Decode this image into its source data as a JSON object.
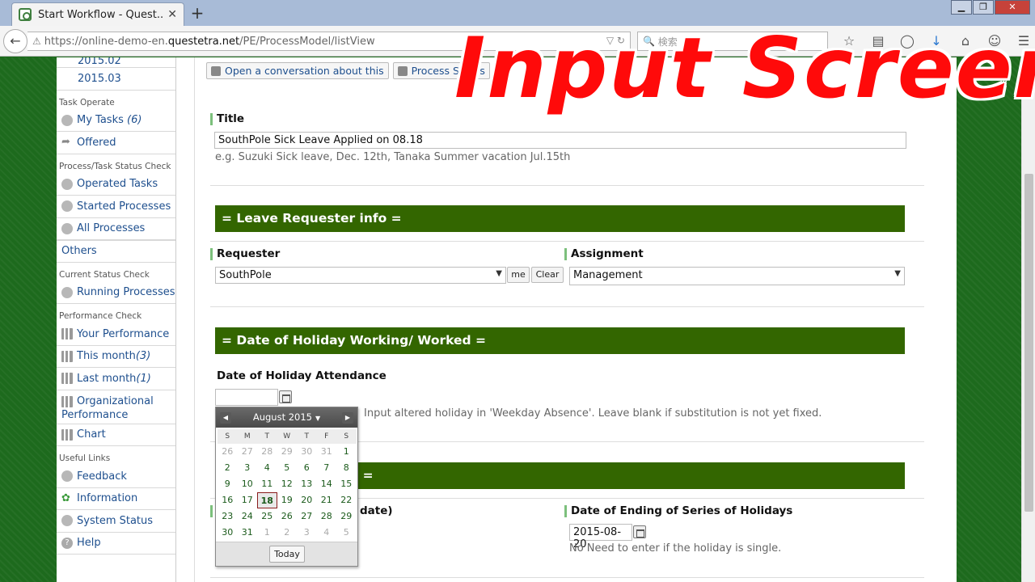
{
  "browser": {
    "tab_title": "Start Workflow - Quest...",
    "tab_close": "✕",
    "new_tab": "+",
    "url_prefix": "https://online-demo-en.",
    "url_host": "questetra.net",
    "url_path": "/PE/ProcessModel/listView",
    "search_placeholder": "検索",
    "window_controls": [
      "▁",
      "❐",
      "✕"
    ]
  },
  "overlay_title": "Input Screen",
  "sidebar": {
    "items_top": [
      {
        "label": "2015.02"
      },
      {
        "label": "2015.03"
      }
    ],
    "task_operate": {
      "heading": "Task Operate",
      "my_tasks": "My Tasks",
      "my_tasks_count": "(6)",
      "offered": "Offered"
    },
    "status_check": {
      "heading": "Process/Task Status Check",
      "operated": "Operated Tasks",
      "started": "Started Processes",
      "all": "All Processes"
    },
    "others": "Others",
    "current": {
      "heading": "Current Status Check",
      "running": "Running Processes"
    },
    "performance": {
      "heading": "Performance Check",
      "yours": "Your Performance",
      "this_month": "This month",
      "this_month_count": "(3)",
      "last_month": "Last month",
      "last_month_count": "(1)",
      "org_line1": "Organizational",
      "org_line2": "Performance",
      "chart": "Chart"
    },
    "links": {
      "heading": "Useful Links",
      "feedback": "Feedback",
      "information": "Information",
      "system_status": "System Status",
      "help": "Help"
    }
  },
  "toolbar": {
    "conversation": "Open a conversation about this",
    "process_status": "Process Status"
  },
  "form": {
    "title_label": "Title",
    "title_value": "SouthPole Sick Leave Applied on 08.18",
    "title_hint": "e.g. Suzuki Sick leave, Dec. 12th, Tanaka Summer vacation Jul.15th",
    "section_requester": "= Leave Requester info =",
    "requester_label": "Requester",
    "requester_value": "SouthPole",
    "me_button": "me",
    "clear_button": "Clear",
    "assignment_label": "Assignment",
    "assignment_value": "Management",
    "section_date": "= Date of Holiday Working/ Worked =",
    "attendance_label": "Date of Holiday Attendance",
    "attendance_value": "",
    "attendance_hint": "Input altered holiday in 'Weekday Absence'. Leave blank if substitution is not yet fixed.",
    "section_third_tail": "s =",
    "start_label_tail": "date)",
    "end_label": "Date of Ending of Series of Holidays",
    "end_value": "2015-08-20",
    "end_hint": "No Need to enter if the holiday is single."
  },
  "datepicker": {
    "month_label": "August 2015",
    "weekdays": [
      "S",
      "M",
      "T",
      "W",
      "T",
      "F",
      "S"
    ],
    "days": [
      {
        "d": "26",
        "other": true
      },
      {
        "d": "27",
        "other": true
      },
      {
        "d": "28",
        "other": true
      },
      {
        "d": "29",
        "other": true
      },
      {
        "d": "30",
        "other": true
      },
      {
        "d": "31",
        "other": true
      },
      {
        "d": "1"
      },
      {
        "d": "2"
      },
      {
        "d": "3"
      },
      {
        "d": "4"
      },
      {
        "d": "5"
      },
      {
        "d": "6"
      },
      {
        "d": "7"
      },
      {
        "d": "8"
      },
      {
        "d": "9"
      },
      {
        "d": "10"
      },
      {
        "d": "11"
      },
      {
        "d": "12"
      },
      {
        "d": "13"
      },
      {
        "d": "14"
      },
      {
        "d": "15"
      },
      {
        "d": "16"
      },
      {
        "d": "17"
      },
      {
        "d": "18",
        "selected": true
      },
      {
        "d": "19"
      },
      {
        "d": "20"
      },
      {
        "d": "21"
      },
      {
        "d": "22"
      },
      {
        "d": "23"
      },
      {
        "d": "24"
      },
      {
        "d": "25"
      },
      {
        "d": "26"
      },
      {
        "d": "27"
      },
      {
        "d": "28"
      },
      {
        "d": "29"
      },
      {
        "d": "30"
      },
      {
        "d": "31"
      },
      {
        "d": "1",
        "other": true
      },
      {
        "d": "2",
        "other": true
      },
      {
        "d": "3",
        "other": true
      },
      {
        "d": "4",
        "other": true
      },
      {
        "d": "5",
        "other": true
      }
    ],
    "today_button": "Today"
  },
  "colors": {
    "section_bar": "#336600",
    "overlay_red": "#ff0a0a",
    "link_blue": "#1e4f8e"
  }
}
